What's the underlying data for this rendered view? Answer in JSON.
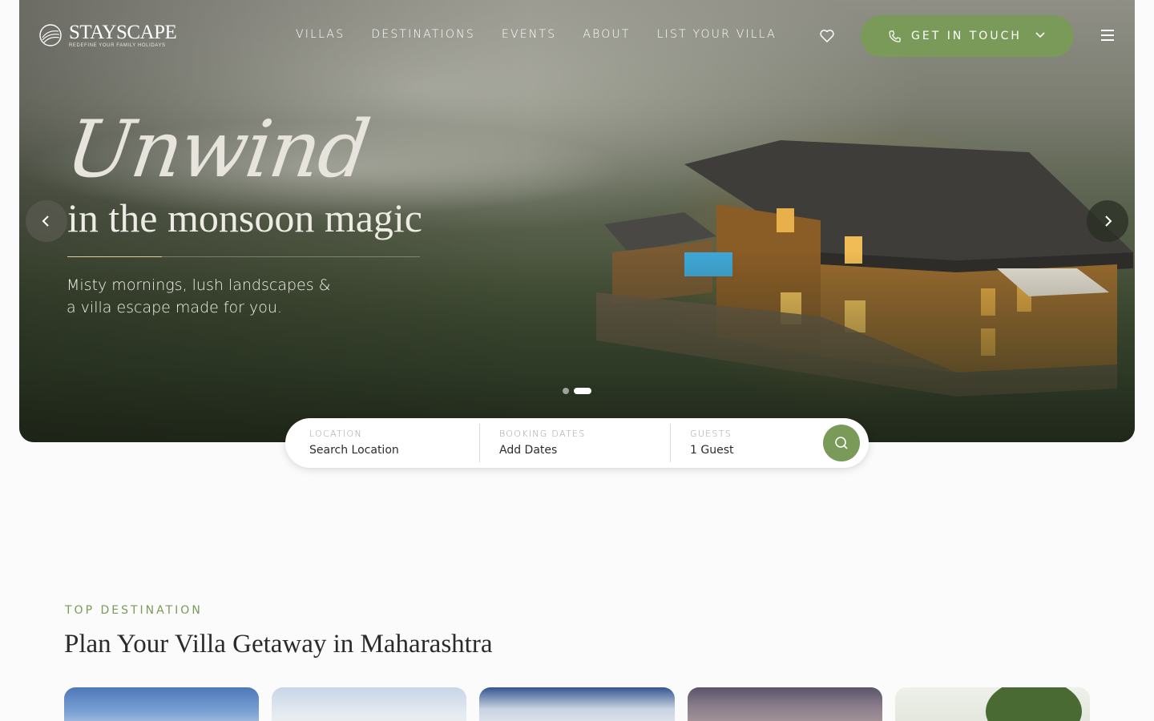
{
  "brand": {
    "name": "STAYSCAPE",
    "tagline": "REDEFINE YOUR FAMILY HOLIDAYS"
  },
  "nav": {
    "items": [
      "VILLAS",
      "DESTINATIONS",
      "EVENTS",
      "ABOUT",
      "LIST YOUR VILLA"
    ]
  },
  "header": {
    "cta_label": "GET IN TOUCH"
  },
  "hero": {
    "script_title": "Unwind",
    "headline": "in the monsoon magic",
    "subtitle_line1": "Misty mornings, lush landscapes &",
    "subtitle_line2": "a villa escape made for you.",
    "slide_count": 2,
    "active_slide": 2
  },
  "search": {
    "location_label": "LOCATION",
    "location_value": "Search Location",
    "dates_label": "BOOKING DATES",
    "dates_value": "Add Dates",
    "guests_label": "GUESTS",
    "guests_value": "1 Guest"
  },
  "section": {
    "kicker": "TOP DESTINATION",
    "title": "Plan Your Villa Getaway in Maharashtra"
  },
  "colors": {
    "accent": "#7a9a59",
    "background": "#fbfbfb",
    "text": "#2b2b2b"
  },
  "icons": [
    "logo-mark-icon",
    "heart-icon",
    "phone-icon",
    "chevron-down-icon",
    "menu-icon",
    "chevron-left-icon",
    "chevron-right-icon",
    "search-icon"
  ]
}
